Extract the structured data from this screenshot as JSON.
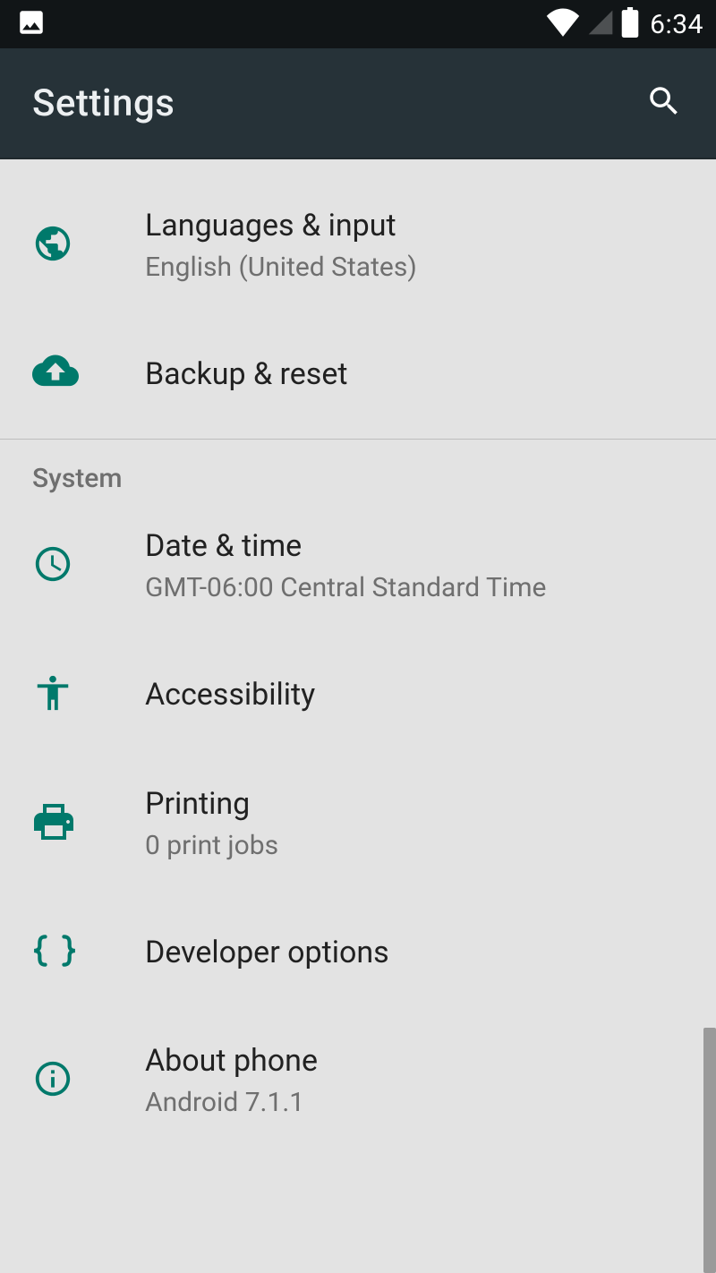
{
  "status": {
    "time": "6:34"
  },
  "appbar": {
    "title": "Settings"
  },
  "sections": {
    "section1_header": "System"
  },
  "items": {
    "languages": {
      "title": "Languages & input",
      "subtitle": "English (United States)"
    },
    "backup": {
      "title": "Backup & reset"
    },
    "datetime": {
      "title": "Date & time",
      "subtitle": "GMT-06:00 Central Standard Time"
    },
    "accessibility": {
      "title": "Accessibility"
    },
    "printing": {
      "title": "Printing",
      "subtitle": "0 print jobs"
    },
    "developer": {
      "title": "Developer options"
    },
    "about": {
      "title": "About phone",
      "subtitle": "Android 7.1.1"
    }
  }
}
